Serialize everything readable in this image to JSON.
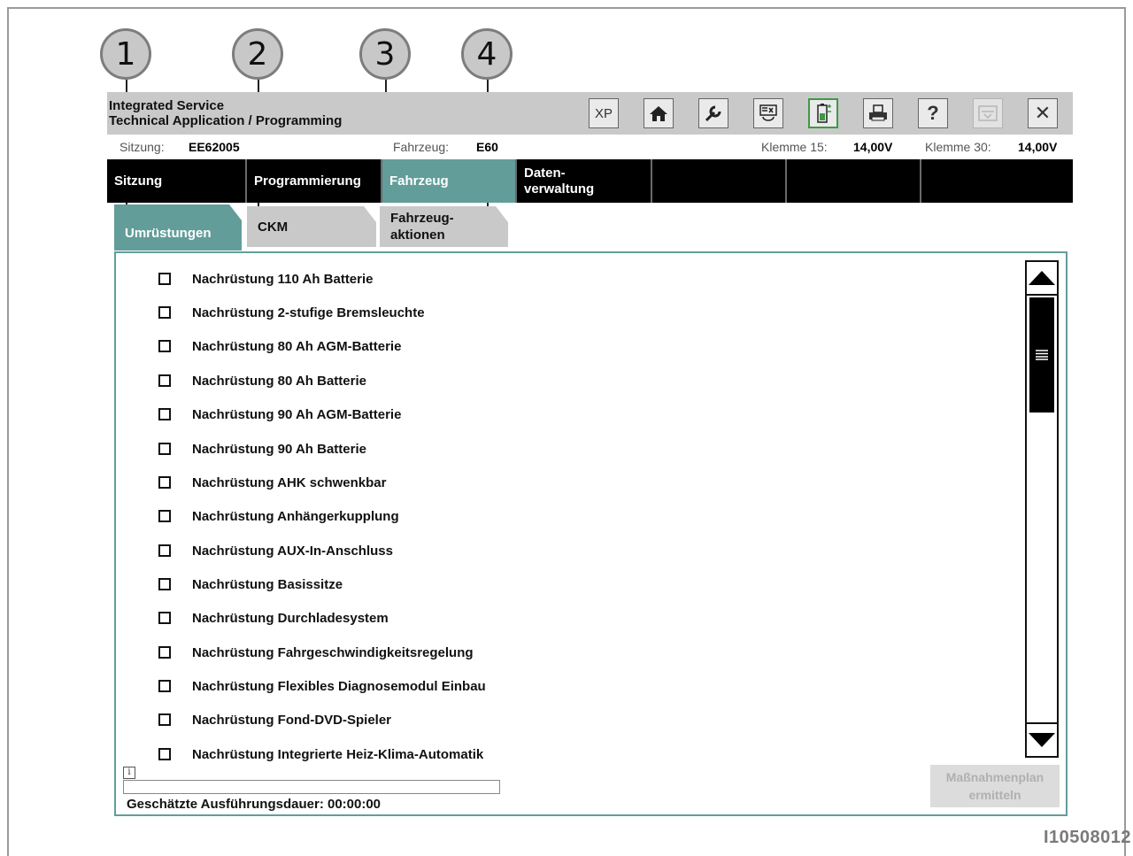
{
  "doc_id": "I10508012",
  "callouts": [
    "1",
    "2",
    "3",
    "4"
  ],
  "app": {
    "title_line1": "Integrated Service",
    "title_line2": "Technical Application / Programming",
    "toolbar": {
      "xp": "XP",
      "buttons": [
        "home-icon",
        "wrench-icon",
        "flash-icon",
        "battery-icon",
        "printer-icon",
        "help-icon",
        "minimize-icon",
        "close-icon"
      ],
      "help": "?",
      "close": "✕"
    }
  },
  "info": {
    "session_label": "Sitzung:",
    "session_value": "EE62005",
    "vehicle_label": "Fahrzeug:",
    "vehicle_value": "E60",
    "k15_label": "Klemme 15:",
    "k15_value": "14,00V",
    "k30_label": "Klemme 30:",
    "k30_value": "14,00V"
  },
  "nav": {
    "items": [
      {
        "label": "Sitzung"
      },
      {
        "label": "Programmierung"
      },
      {
        "label": "Fahrzeug"
      },
      {
        "label_line1": "Daten-",
        "label_line2": "verwaltung"
      }
    ],
    "active_index": 2
  },
  "subtabs": {
    "items": [
      {
        "label": "Umrüstungen"
      },
      {
        "label": "CKM"
      },
      {
        "label_line1": "Fahrzeug-",
        "label_line2": "aktionen"
      }
    ],
    "active_index": 0
  },
  "list": {
    "items": [
      "Nachrüstung 110 Ah Batterie",
      "Nachrüstung 2-stufige Bremsleuchte",
      "Nachrüstung 80 Ah AGM-Batterie",
      "Nachrüstung 80 Ah Batterie",
      "Nachrüstung 90 Ah AGM-Batterie",
      "Nachrüstung 90 Ah Batterie",
      "Nachrüstung AHK schwenkbar",
      "Nachrüstung Anhängerkupplung",
      "Nachrüstung AUX-In-Anschluss",
      "Nachrüstung Basissitze",
      "Nachrüstung Durchladesystem",
      "Nachrüstung Fahrgeschwindigkeitsregelung",
      "Nachrüstung Flexibles Diagnosemodul Einbau",
      "Nachrüstung Fond-DVD-Spieler",
      "Nachrüstung Integrierte Heiz-Klima-Automatik"
    ]
  },
  "footer": {
    "info_icon": "i",
    "duration": "Geschätzte Ausführungsdauer: 00:00:00",
    "action_line1": "Maßnahmenplan",
    "action_line2": "ermitteln"
  }
}
